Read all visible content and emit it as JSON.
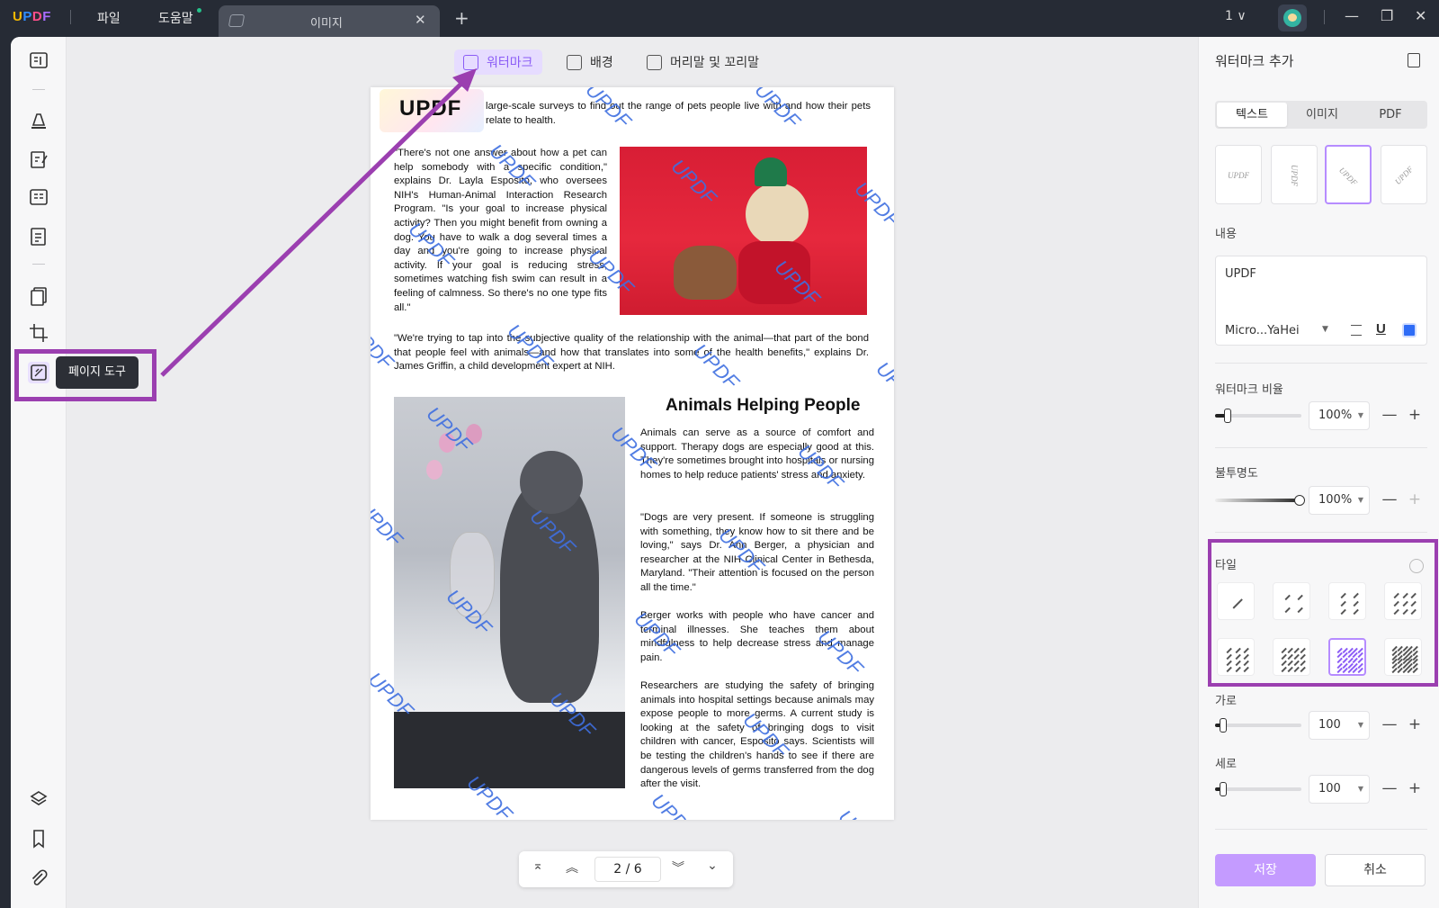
{
  "titlebar": {
    "logo": "UPDF",
    "menu_file": "파일",
    "menu_help": "도움말",
    "tab_title": "이미지",
    "tab_close": "✕",
    "new_tab": "+",
    "page_selector": "1 ∨",
    "window_minimize": "—",
    "window_restore": "❐",
    "window_close": "✕"
  },
  "toptools": {
    "watermark": "워터마크",
    "background": "배경",
    "header_footer": "머리말 및 꼬리말"
  },
  "left_tooltip": "페이지 도구",
  "document": {
    "logo_text": "UPDF",
    "intro": "large-scale surveys to find out the range of pets people live with and how their pets relate to health.",
    "para1": "\"There's not one answer about how a pet can help somebody with a specific condition,\" explains Dr. Layla Esposito, who oversees NIH's Human-Animal Interaction Research Program. \"Is your goal to increase physical activity? Then you might benefit from owning a dog. You have to walk a dog several times a day and you're going to increase physical activity. If your goal is reducing stress, sometimes watching fish swim can result in a feeling of calmness. So there's no one type fits all.\"",
    "para2": "\"We're trying to tap into the subjective quality of the relationship with the animal—that part of the bond that people feel with animals—and how that translates into some of the health benefits,\" explains Dr. James Griffin, a child development expert at NIH.",
    "heading": "Animals Helping People",
    "para3": "Animals can serve as a source of comfort and support. Therapy dogs are especially good at this. They're sometimes brought into hospitals or nursing homes to help reduce patients' stress and anxiety.",
    "para4": "\"Dogs are very present. If someone is struggling with something, they know how to sit there and be loving,\" says Dr. Ann Berger, a physician and researcher at the NIH Clinical Center in Bethesda, Maryland. \"Their attention is focused on the person all the time.\"",
    "para5": "Berger works with people who have cancer and terminal illnesses. She teaches them about mindfulness to help decrease stress and manage pain.",
    "para6": "Researchers are studying the safety of bringing animals into hospital settings because animals may expose people to more germs. A current study is looking at the safety of bringing dogs to visit children with cancer, Esposito says. Scientists will be testing the children's hands to see if there are dangerous levels of germs transferred from the dog after the visit.",
    "watermark_text": "UPDF"
  },
  "pager": {
    "first": "⌅",
    "prev": "︽",
    "page_display": "2 / 6",
    "next": "︾",
    "last": "⌄"
  },
  "panel": {
    "title": "워터마크 추가",
    "seg_text": "텍스트",
    "seg_image": "이미지",
    "seg_pdf": "PDF",
    "style_sample": "UPDF",
    "content_label": "내용",
    "content_value": "UPDF",
    "font_name": "Micro...YaHei",
    "font_dropdown": "▼",
    "underline": "U",
    "ratio_label": "워터마크 비율",
    "ratio_value": "100%",
    "ratio_level": 0.1,
    "opacity_label": "불투명도",
    "opacity_value": "100%",
    "opacity_level": 1.0,
    "tile_label": "타일",
    "horizontal_label": "가로",
    "horizontal_value": "100",
    "horizontal_level": 0.05,
    "vertical_label": "세로",
    "vertical_value": "100",
    "vertical_level": 0.05,
    "minus": "—",
    "plus": "+",
    "save": "저장",
    "cancel": "취소"
  },
  "colors": {
    "accent": "#8b5cf6",
    "highlight": "#9b3fb0",
    "watermark": "#3f6fe0",
    "save_button": "#c49bff"
  }
}
